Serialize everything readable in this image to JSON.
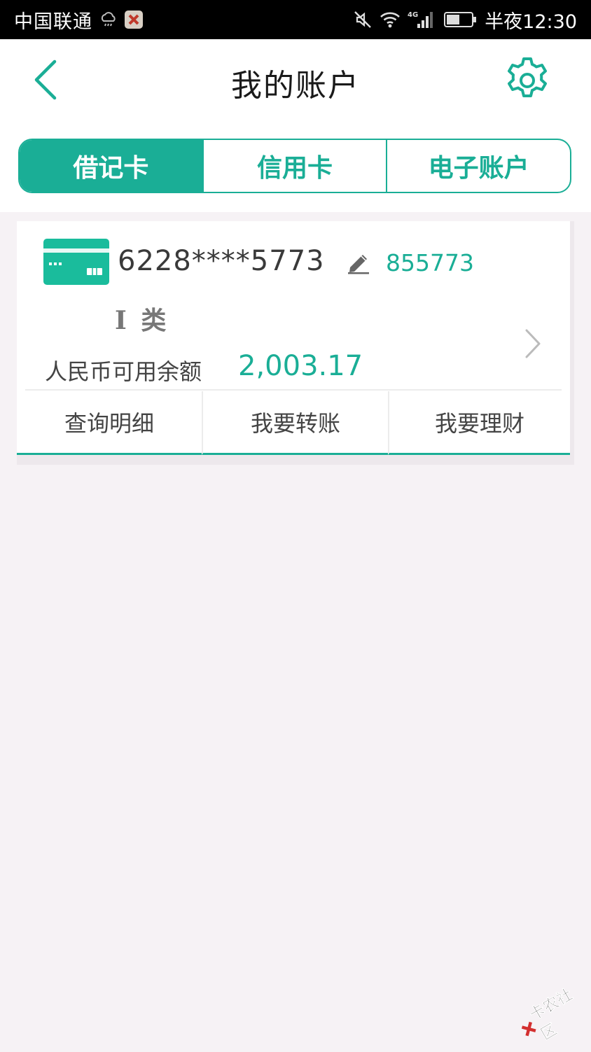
{
  "status_bar": {
    "carrier": "中国联通",
    "time": "半夜12:30",
    "network_label": "4G"
  },
  "nav": {
    "title": "我的账户"
  },
  "tabs": [
    {
      "label": "借记卡",
      "active": true
    },
    {
      "label": "信用卡",
      "active": false
    },
    {
      "label": "电子账户",
      "active": false
    }
  ],
  "card": {
    "number": "6228****5773",
    "alias": "855773",
    "class_label": "I 类",
    "balance_label": "人民币可用余额",
    "balance_value": "2,003.17"
  },
  "actions": [
    {
      "label": "查询明细"
    },
    {
      "label": "我要转账"
    },
    {
      "label": "我要理财"
    }
  ],
  "watermark": {
    "text": "卡农社区"
  },
  "colors": {
    "accent": "#1aae96",
    "background": "#f6f2f5",
    "card_icon": "#1abc9c"
  }
}
